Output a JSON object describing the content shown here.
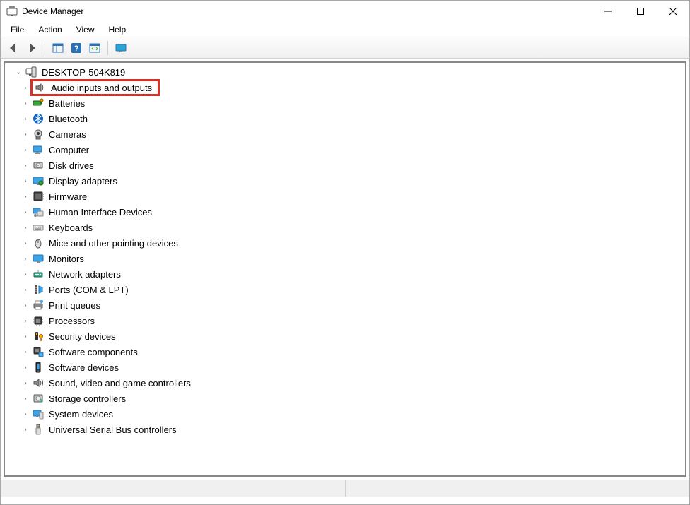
{
  "window": {
    "title": "Device Manager"
  },
  "menu": {
    "file": "File",
    "action": "Action",
    "view": "View",
    "help": "Help"
  },
  "tree": {
    "root": "DESKTOP-504K819",
    "items": [
      {
        "label": "Audio inputs and outputs",
        "icon": "speaker",
        "highlighted": true
      },
      {
        "label": "Batteries",
        "icon": "battery"
      },
      {
        "label": "Bluetooth",
        "icon": "bluetooth"
      },
      {
        "label": "Cameras",
        "icon": "camera"
      },
      {
        "label": "Computer",
        "icon": "computer"
      },
      {
        "label": "Disk drives",
        "icon": "disk"
      },
      {
        "label": "Display adapters",
        "icon": "display"
      },
      {
        "label": "Firmware",
        "icon": "firmware"
      },
      {
        "label": "Human Interface Devices",
        "icon": "hid"
      },
      {
        "label": "Keyboards",
        "icon": "keyboard"
      },
      {
        "label": "Mice and other pointing devices",
        "icon": "mouse"
      },
      {
        "label": "Monitors",
        "icon": "monitor"
      },
      {
        "label": "Network adapters",
        "icon": "network"
      },
      {
        "label": "Ports (COM & LPT)",
        "icon": "port"
      },
      {
        "label": "Print queues",
        "icon": "printer"
      },
      {
        "label": "Processors",
        "icon": "cpu"
      },
      {
        "label": "Security devices",
        "icon": "security"
      },
      {
        "label": "Software components",
        "icon": "swcomp"
      },
      {
        "label": "Software devices",
        "icon": "swdev"
      },
      {
        "label": "Sound, video and game controllers",
        "icon": "sound"
      },
      {
        "label": "Storage controllers",
        "icon": "storage"
      },
      {
        "label": "System devices",
        "icon": "system"
      },
      {
        "label": "Universal Serial Bus controllers",
        "icon": "usb"
      }
    ]
  }
}
